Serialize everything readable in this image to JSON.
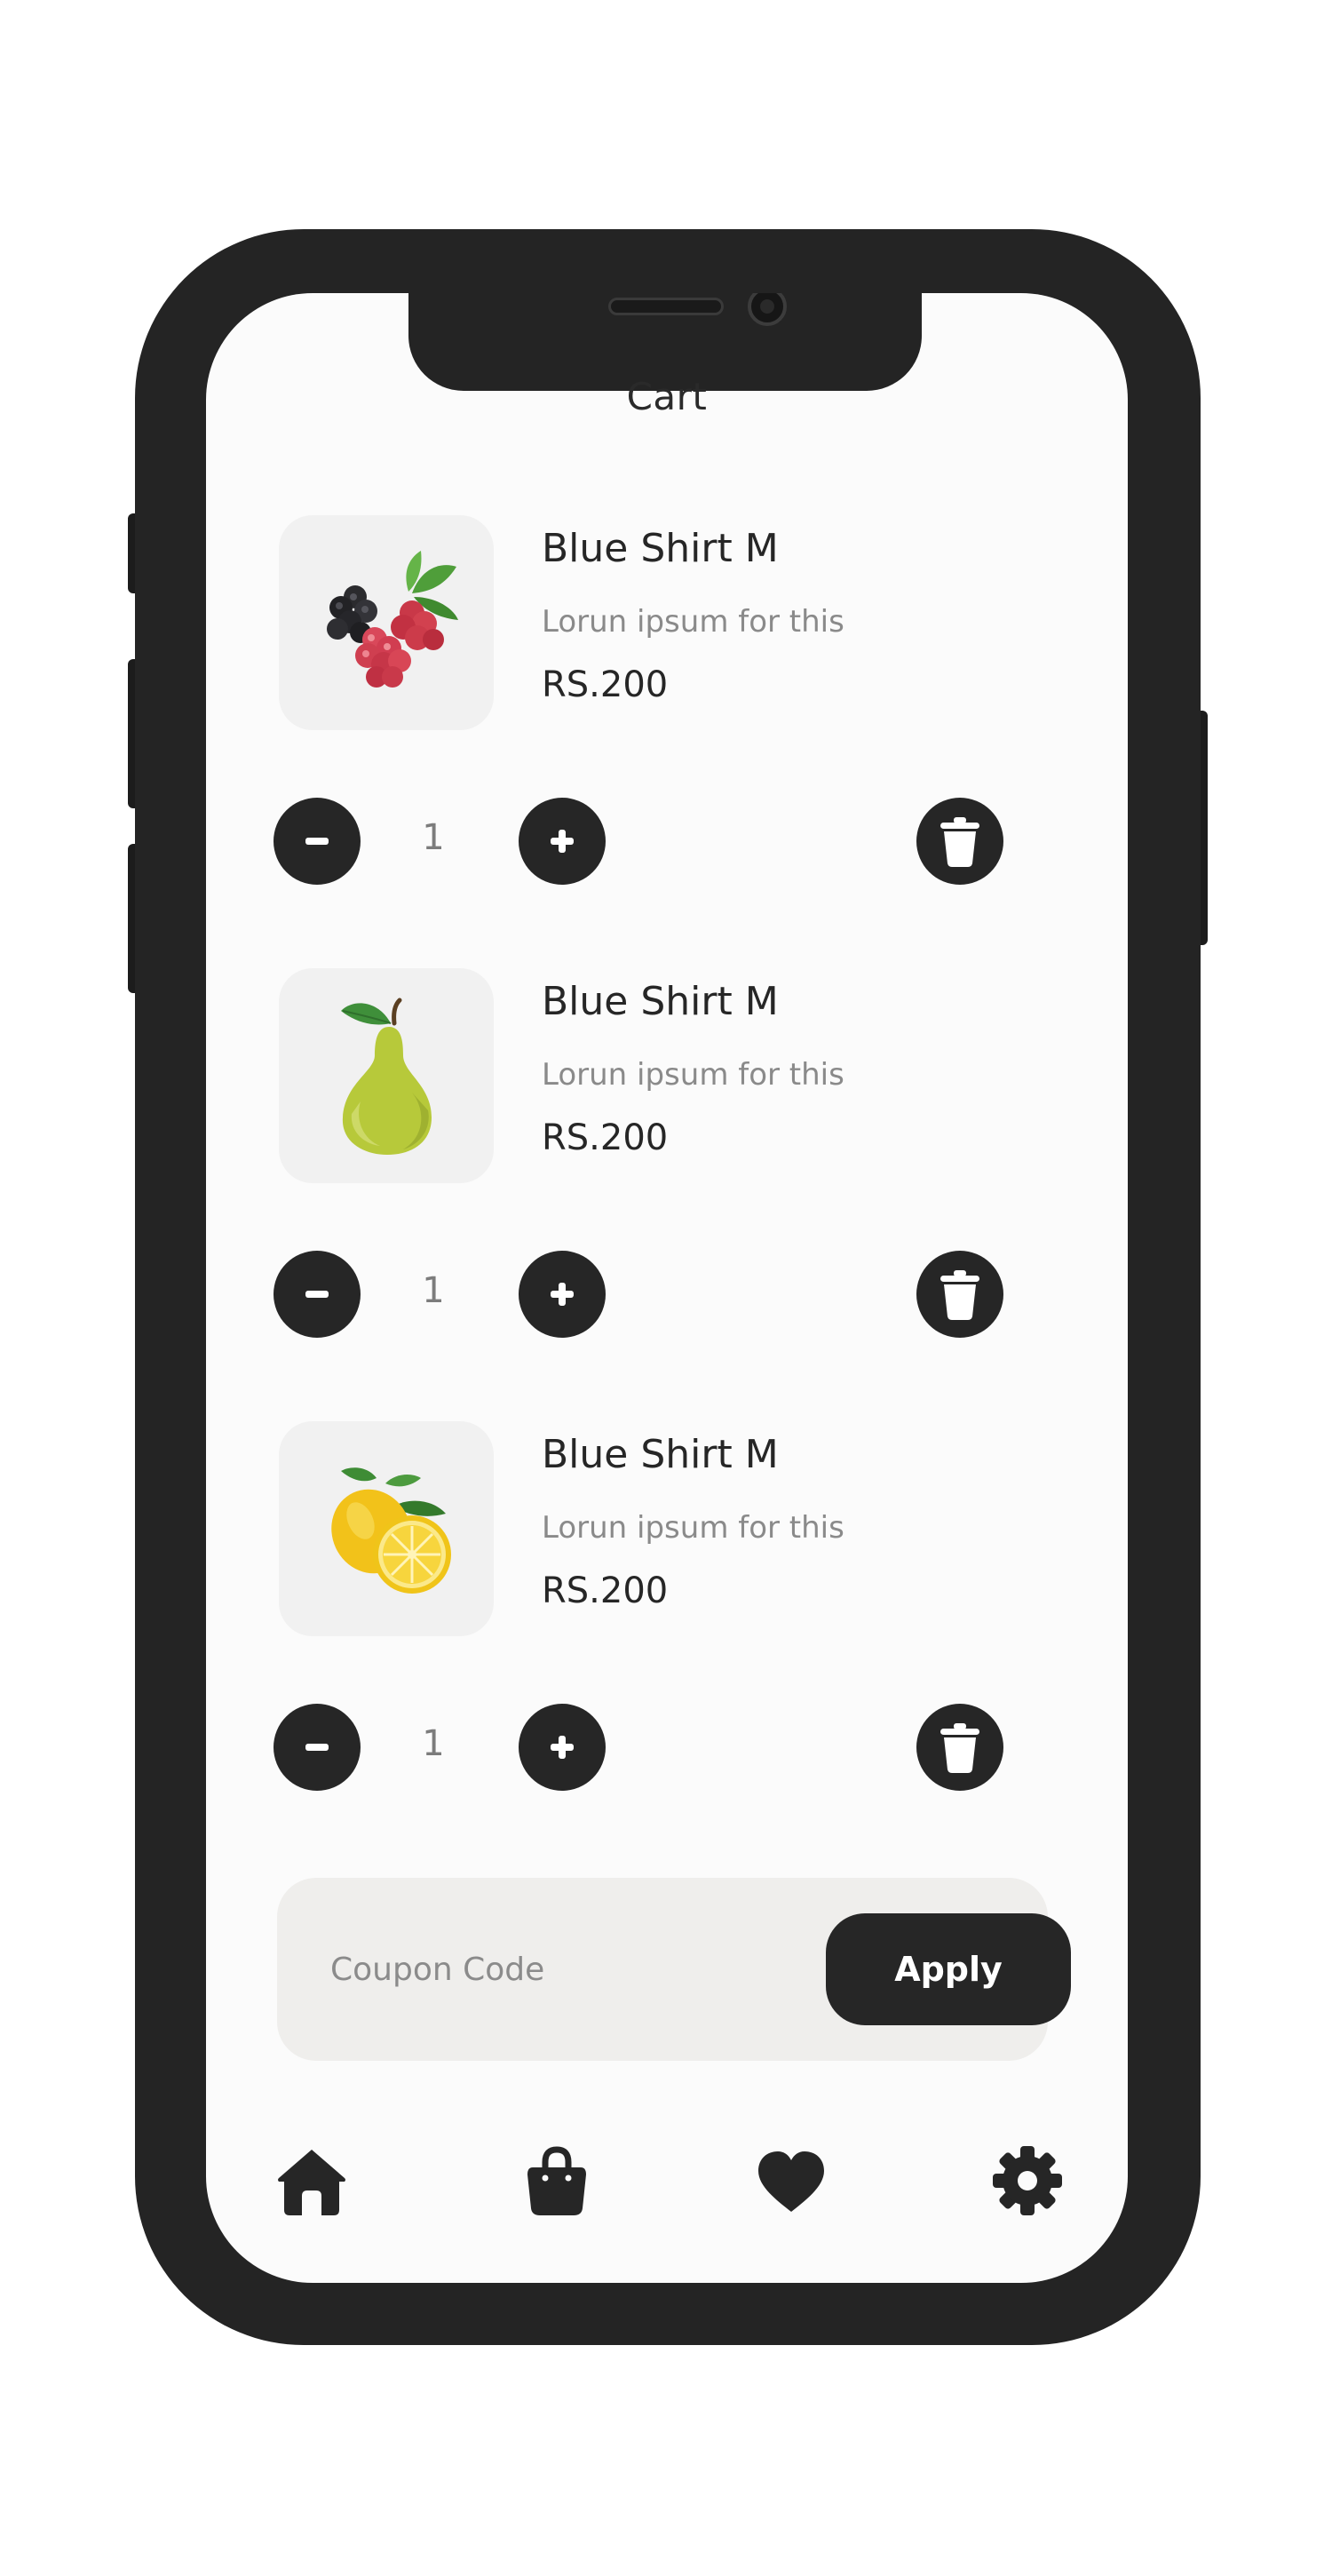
{
  "header": {
    "title": "Cart"
  },
  "cart": {
    "items": [
      {
        "name": "Blue Shirt M",
        "description": "Lorun ipsum for this",
        "price": "RS.200",
        "quantity": "1",
        "image": "mixed-berries"
      },
      {
        "name": "Blue Shirt M",
        "description": "Lorun ipsum for this",
        "price": "RS.200",
        "quantity": "1",
        "image": "green-pear"
      },
      {
        "name": "Blue Shirt M",
        "description": "Lorun ipsum for this",
        "price": "RS.200",
        "quantity": "1",
        "image": "lemons"
      }
    ]
  },
  "icons": {
    "decrease": "minus-icon",
    "increase": "plus-icon",
    "delete": "trash-icon"
  },
  "coupon": {
    "placeholder": "Coupon Code",
    "apply_label": "Apply"
  },
  "bottom_nav": {
    "items": [
      {
        "icon": "home-icon"
      },
      {
        "icon": "shopping-bag-icon"
      },
      {
        "icon": "heart-icon"
      },
      {
        "icon": "settings-gear-icon"
      }
    ]
  },
  "colors": {
    "phone_frame": "#242424",
    "screen_background": "#fbfbfb",
    "dark_accent": "#262626",
    "muted_text": "#8a8a8a",
    "thumbnail_background": "#f1f1f1",
    "coupon_background": "#efeeec"
  }
}
